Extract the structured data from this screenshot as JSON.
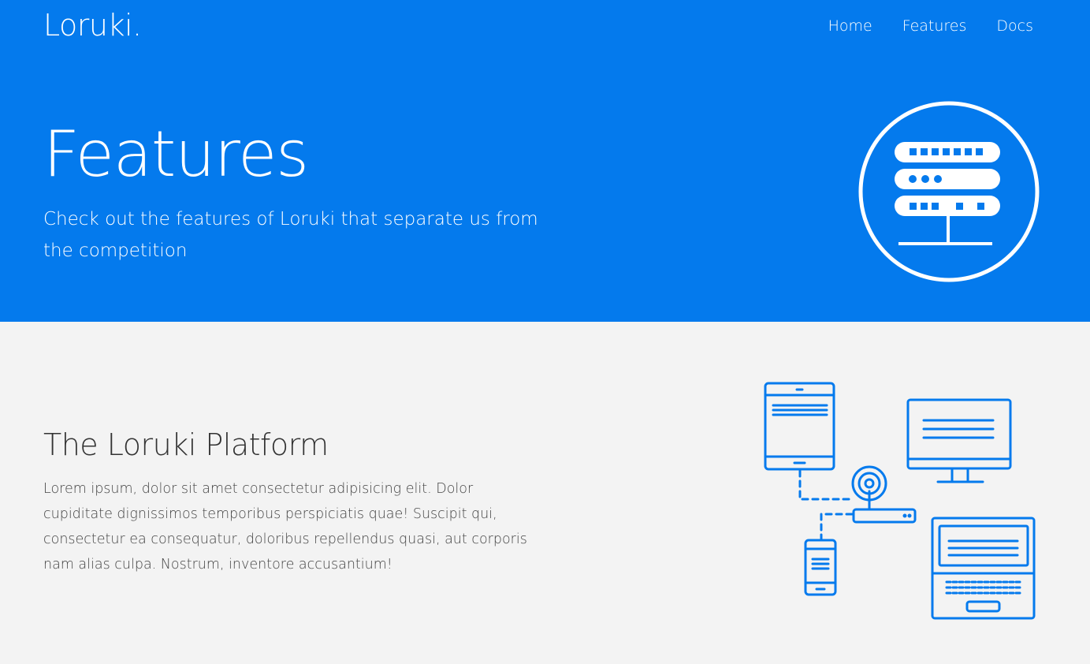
{
  "brand": "Loruki.",
  "nav": {
    "home": "Home",
    "features": "Features",
    "docs": "Docs"
  },
  "hero": {
    "title": "Features",
    "subtitle": "Check out the features of Loruki that separate us from the competition",
    "icon": "server-rack-icon"
  },
  "platform": {
    "title": "The Loruki Platform",
    "text": "Lorem ipsum, dolor sit amet consectetur adipisicing elit. Dolor cupiditate dignissimos temporibus perspiciatis quae! Suscipit qui, consectetur ea consequatur, doloribus repellendus quasi, aut corporis nam alias culpa. Nostrum, inventore accusantium!",
    "illustration": "network-devices-illustration"
  },
  "colors": {
    "primary": "#047aed",
    "background": "#f3f3f3",
    "text": "#333333"
  }
}
